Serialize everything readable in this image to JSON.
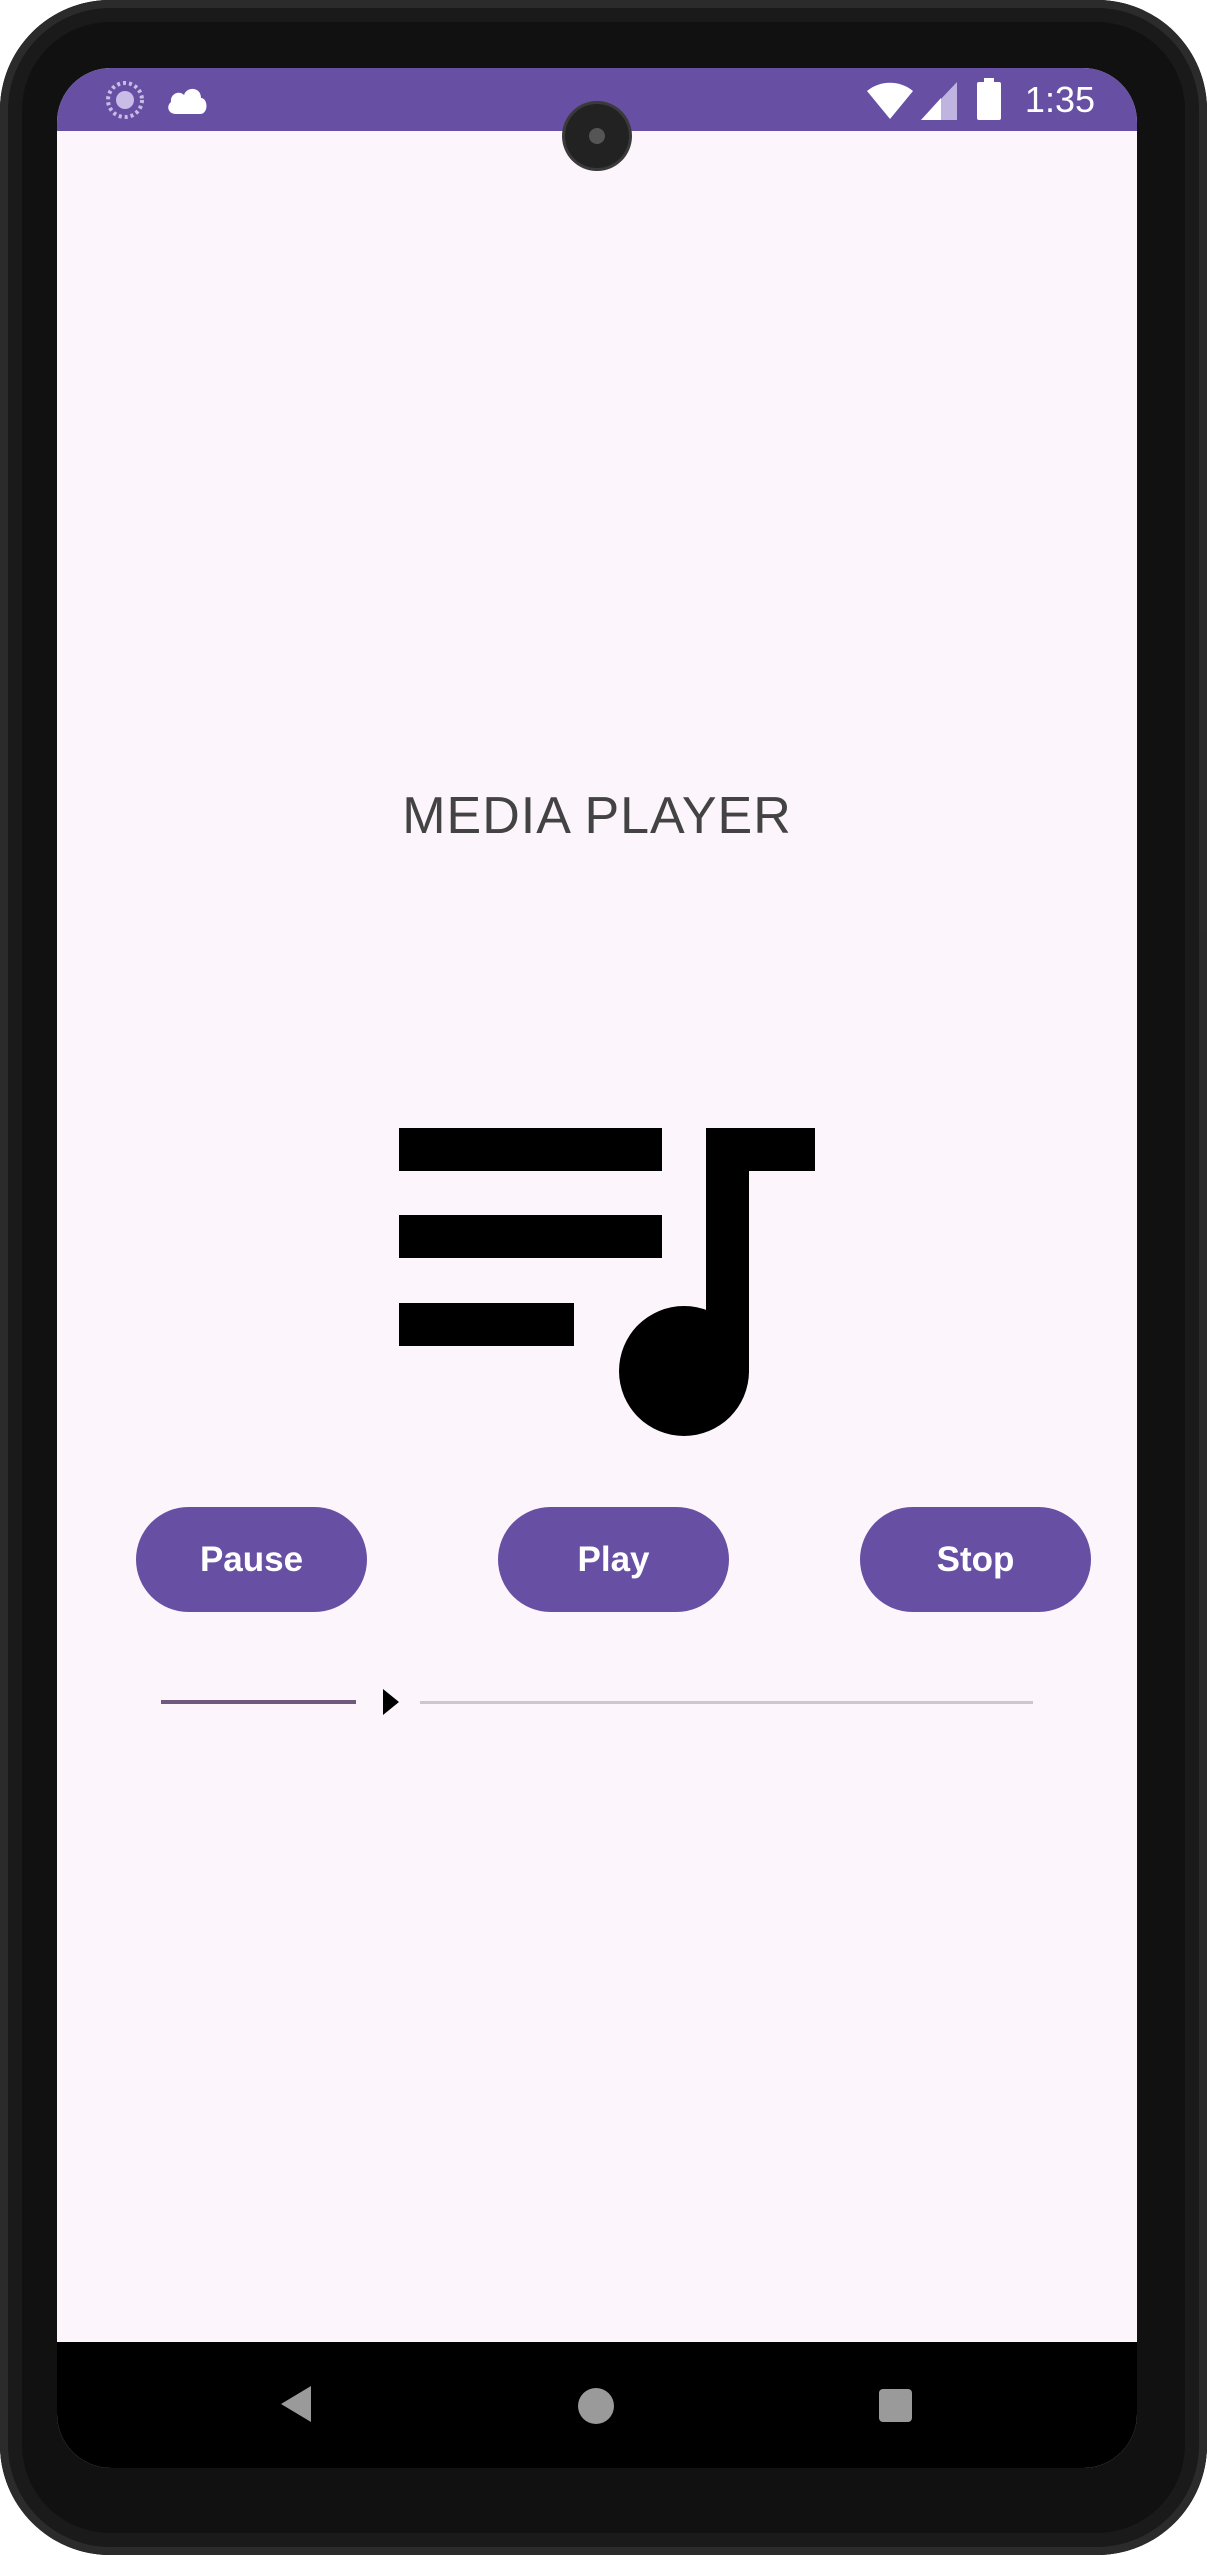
{
  "status_bar": {
    "time": "1:35",
    "icons": [
      "sync-icon",
      "cloud-icon",
      "wifi-icon",
      "signal-icon",
      "battery-icon"
    ]
  },
  "app": {
    "title": "MEDIA PLAYER",
    "artwork_icon": "queue-music-icon"
  },
  "controls": {
    "pause_label": "Pause",
    "play_label": "Play",
    "stop_label": "Stop"
  },
  "seekbar": {
    "progress_percent": 34
  },
  "nav_bar": {
    "icons": [
      "back-icon",
      "home-icon",
      "recents-icon"
    ]
  },
  "colors": {
    "primary": "#6750a4",
    "background": "#fcf5fb",
    "title_text": "#434343",
    "seek_played": "#6f5a7e",
    "seek_track": "#cfc5cf"
  }
}
